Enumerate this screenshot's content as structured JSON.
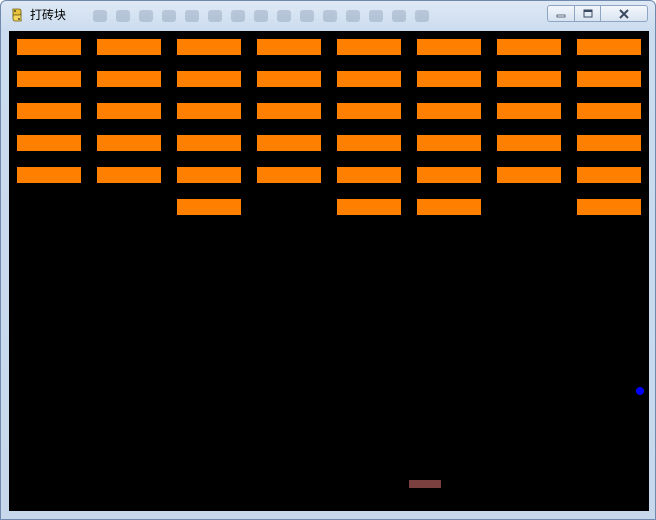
{
  "window": {
    "title": "打砖块",
    "controls": {
      "minimize_icon": "minimize-icon",
      "maximize_icon": "maximize-icon",
      "close_icon": "close-icon"
    }
  },
  "game": {
    "background_color": "#000000",
    "brick_color": "#ff8000",
    "paddle_color": "#7a4040",
    "ball_color": "#0000ff",
    "brick_rows": [
      [
        1,
        1,
        1,
        1,
        1,
        1,
        1,
        1
      ],
      [
        1,
        1,
        1,
        1,
        1,
        1,
        1,
        1
      ],
      [
        1,
        1,
        1,
        1,
        1,
        1,
        1,
        1
      ],
      [
        1,
        1,
        1,
        1,
        1,
        1,
        1,
        1
      ],
      [
        1,
        1,
        1,
        1,
        1,
        1,
        1,
        1
      ],
      [
        0,
        0,
        1,
        0,
        1,
        1,
        0,
        1
      ]
    ]
  }
}
